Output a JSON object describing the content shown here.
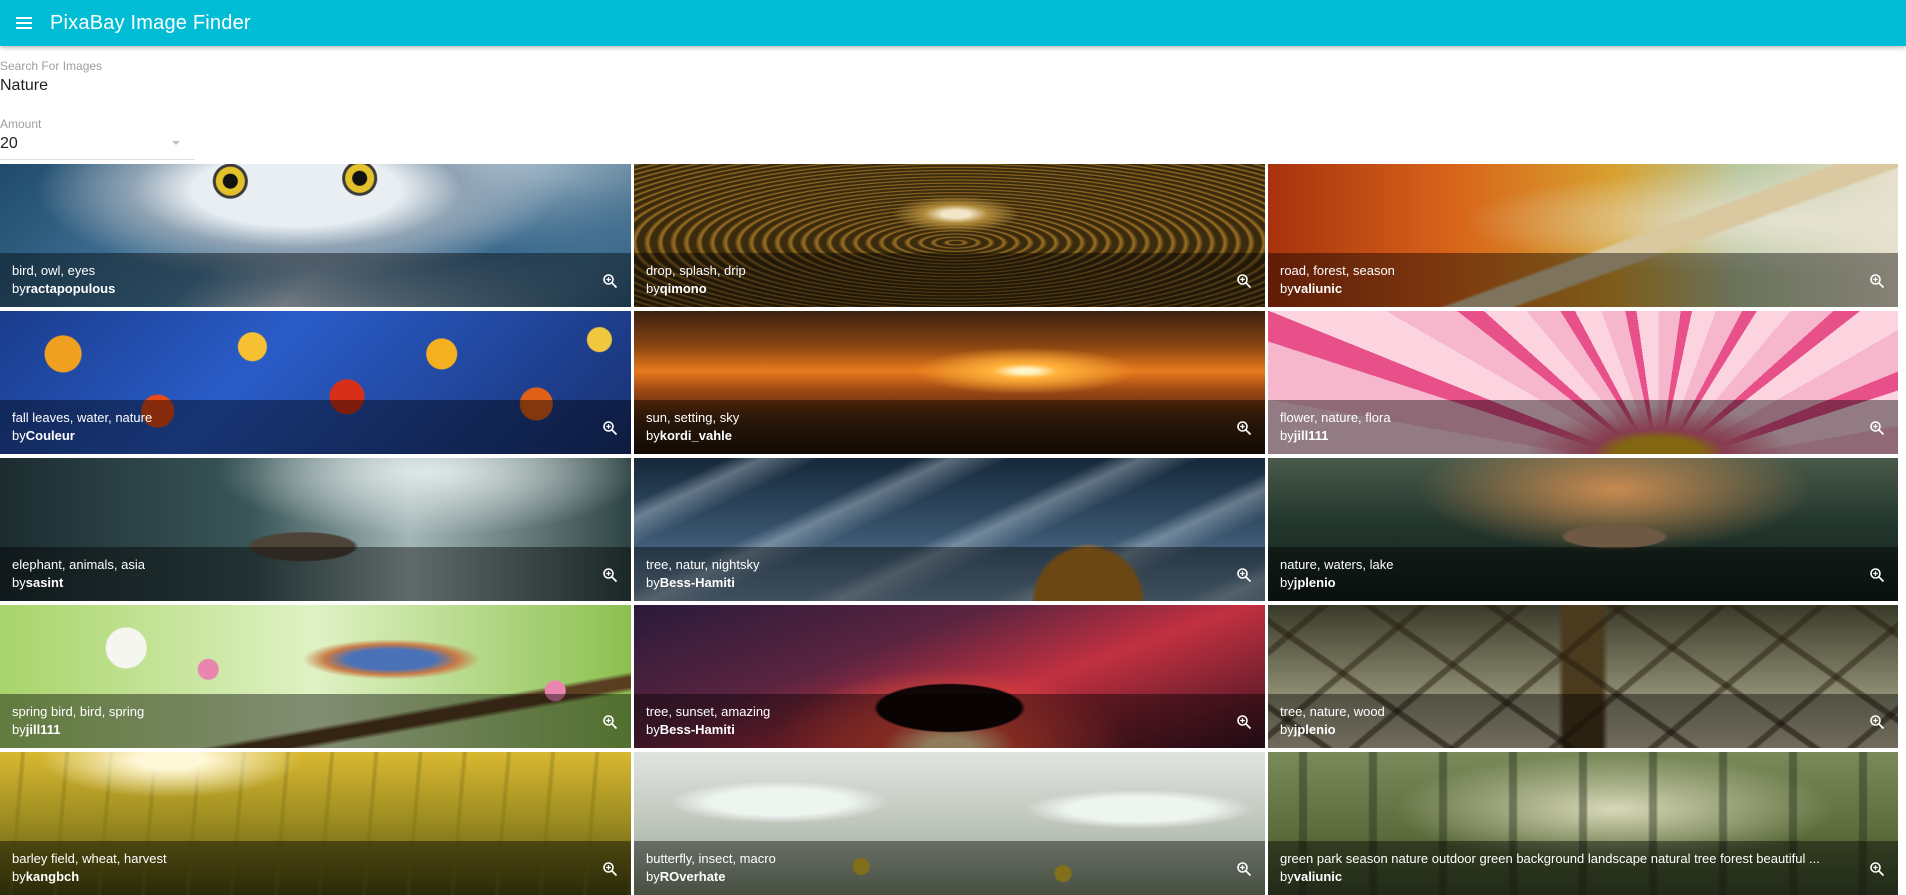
{
  "app": {
    "title": "PixaBay Image Finder",
    "accent_color": "#00bcd4",
    "menu_icon": "hamburger-menu-icon"
  },
  "search": {
    "label": "Search For Images",
    "value": "Nature"
  },
  "amount": {
    "label": "Amount",
    "value": "20",
    "dropdown_icon": "caret-down-icon"
  },
  "results": [
    {
      "tags": "bird, owl, eyes",
      "by_prefix": "by",
      "user": "ractapopulous",
      "zoom_icon": "zoom-in-icon"
    },
    {
      "tags": "drop, splash, drip",
      "by_prefix": "by",
      "user": "qimono",
      "zoom_icon": "zoom-in-icon"
    },
    {
      "tags": "road, forest, season",
      "by_prefix": "by",
      "user": "valiunic",
      "zoom_icon": "zoom-in-icon"
    },
    {
      "tags": "fall leaves, water, nature",
      "by_prefix": "by",
      "user": "Couleur",
      "zoom_icon": "zoom-in-icon"
    },
    {
      "tags": "sun, setting, sky",
      "by_prefix": "by",
      "user": "kordi_vahle",
      "zoom_icon": "zoom-in-icon"
    },
    {
      "tags": "flower, nature, flora",
      "by_prefix": "by",
      "user": "jill111",
      "zoom_icon": "zoom-in-icon"
    },
    {
      "tags": "elephant, animals, asia",
      "by_prefix": "by",
      "user": "sasint",
      "zoom_icon": "zoom-in-icon"
    },
    {
      "tags": "tree, natur, nightsky",
      "by_prefix": "by",
      "user": "Bess-Hamiti",
      "zoom_icon": "zoom-in-icon"
    },
    {
      "tags": "nature, waters, lake",
      "by_prefix": "by",
      "user": "jplenio",
      "zoom_icon": "zoom-in-icon"
    },
    {
      "tags": "spring bird, bird, spring",
      "by_prefix": "by",
      "user": "jill111",
      "zoom_icon": "zoom-in-icon"
    },
    {
      "tags": "tree, sunset, amazing",
      "by_prefix": "by",
      "user": "Bess-Hamiti",
      "zoom_icon": "zoom-in-icon"
    },
    {
      "tags": "tree, nature, wood",
      "by_prefix": "by",
      "user": "jplenio",
      "zoom_icon": "zoom-in-icon"
    },
    {
      "tags": "barley field, wheat, harvest",
      "by_prefix": "by",
      "user": "kangbch",
      "zoom_icon": "zoom-in-icon"
    },
    {
      "tags": "butterfly, insect, macro",
      "by_prefix": "by",
      "user": "ROverhate",
      "zoom_icon": "zoom-in-icon"
    },
    {
      "tags": "green park season nature outdoor green background landscape natural tree forest beautiful ...",
      "by_prefix": "by",
      "user": "valiunic",
      "zoom_icon": "zoom-in-icon"
    }
  ]
}
